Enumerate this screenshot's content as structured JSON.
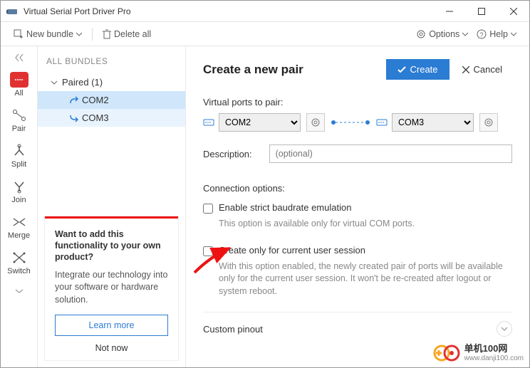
{
  "window": {
    "title": "Virtual Serial Port Driver Pro"
  },
  "toolbar": {
    "new_bundle": "New bundle",
    "delete_all": "Delete all",
    "options": "Options",
    "help": "Help"
  },
  "sidebar": {
    "items": [
      {
        "label": "All"
      },
      {
        "label": "Pair"
      },
      {
        "label": "Split"
      },
      {
        "label": "Join"
      },
      {
        "label": "Merge"
      },
      {
        "label": "Switch"
      }
    ]
  },
  "tree": {
    "header": "ALL BUNDLES",
    "group_label": "Paired (1)",
    "ports": [
      "COM2",
      "COM3"
    ]
  },
  "promo": {
    "title": "Want to add this functionality to your own product?",
    "desc": "Integrate our technology into your software or hardware solution.",
    "learn": "Learn more",
    "notnow": "Not now"
  },
  "content": {
    "heading": "Create a new pair",
    "create": "Create",
    "cancel": "Cancel",
    "vp_label": "Virtual ports to pair:",
    "port_a": "COM2",
    "port_b": "COM3",
    "desc_label": "Description:",
    "desc_placeholder": "(optional)",
    "conn_opts": "Connection options:",
    "opt1_label": "Enable strict baudrate emulation",
    "opt1_desc": "This option is available only for virtual COM ports.",
    "opt2_label": "Create only for current user session",
    "opt2_desc": "With this option enabled, the newly created pair of ports will be available only for the current user session. It won't be re-created after logout or system reboot.",
    "pinout": "Custom pinout"
  },
  "watermark": {
    "cn": "单机100网",
    "url": "www.danji100.com"
  }
}
